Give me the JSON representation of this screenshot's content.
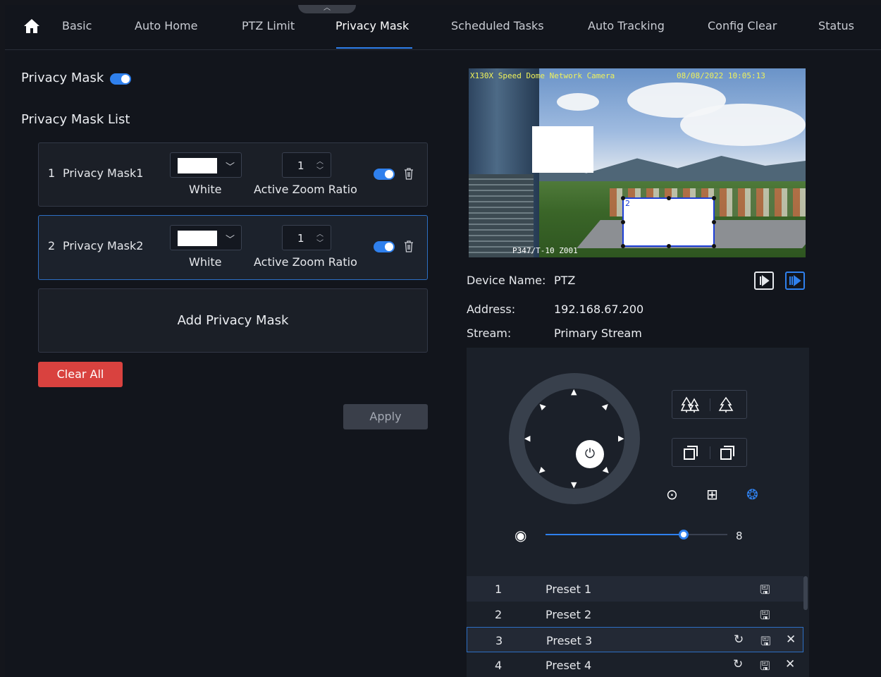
{
  "nav": {
    "tabs": [
      "Basic",
      "Auto Home",
      "PTZ Limit",
      "Privacy Mask",
      "Scheduled Tasks",
      "Auto Tracking",
      "Config Clear",
      "Status"
    ],
    "active_tab": "Privacy Mask"
  },
  "privacy_mask": {
    "label": "Privacy Mask",
    "enabled": true,
    "list_label": "Privacy Mask List",
    "items": [
      {
        "index": "1",
        "name": "Privacy Mask1",
        "color": "White",
        "zoom_value": "1",
        "zoom_label": "Active Zoom Ratio",
        "enabled": true
      },
      {
        "index": "2",
        "name": "Privacy Mask2",
        "color": "White",
        "zoom_value": "1",
        "zoom_label": "Active Zoom Ratio",
        "enabled": true
      }
    ],
    "add_label": "Add Privacy Mask",
    "clear_label": "Clear All",
    "apply_label": "Apply"
  },
  "video": {
    "osd_title": "X130X Speed Dome Network Camera",
    "osd_time": "08/08/2022 10:05:13",
    "osd_ptz": "P347/T-10  Z001",
    "mask_number": "2"
  },
  "device": {
    "name_label": "Device Name:",
    "name_value": "PTZ",
    "address_label": "Address:",
    "address_value": "192.168.67.200",
    "stream_label": "Stream:",
    "stream_value": "Primary Stream"
  },
  "ptz": {
    "speed_value": "8",
    "speed_fraction": 0.76,
    "presets": [
      {
        "num": "1",
        "label": "Preset 1"
      },
      {
        "num": "2",
        "label": "Preset 2"
      },
      {
        "num": "3",
        "label": "Preset 3"
      },
      {
        "num": "4",
        "label": "Preset 4"
      }
    ]
  },
  "colors": {
    "accent": "#2f80ed",
    "danger": "#d9423f",
    "background": "#12151c"
  }
}
